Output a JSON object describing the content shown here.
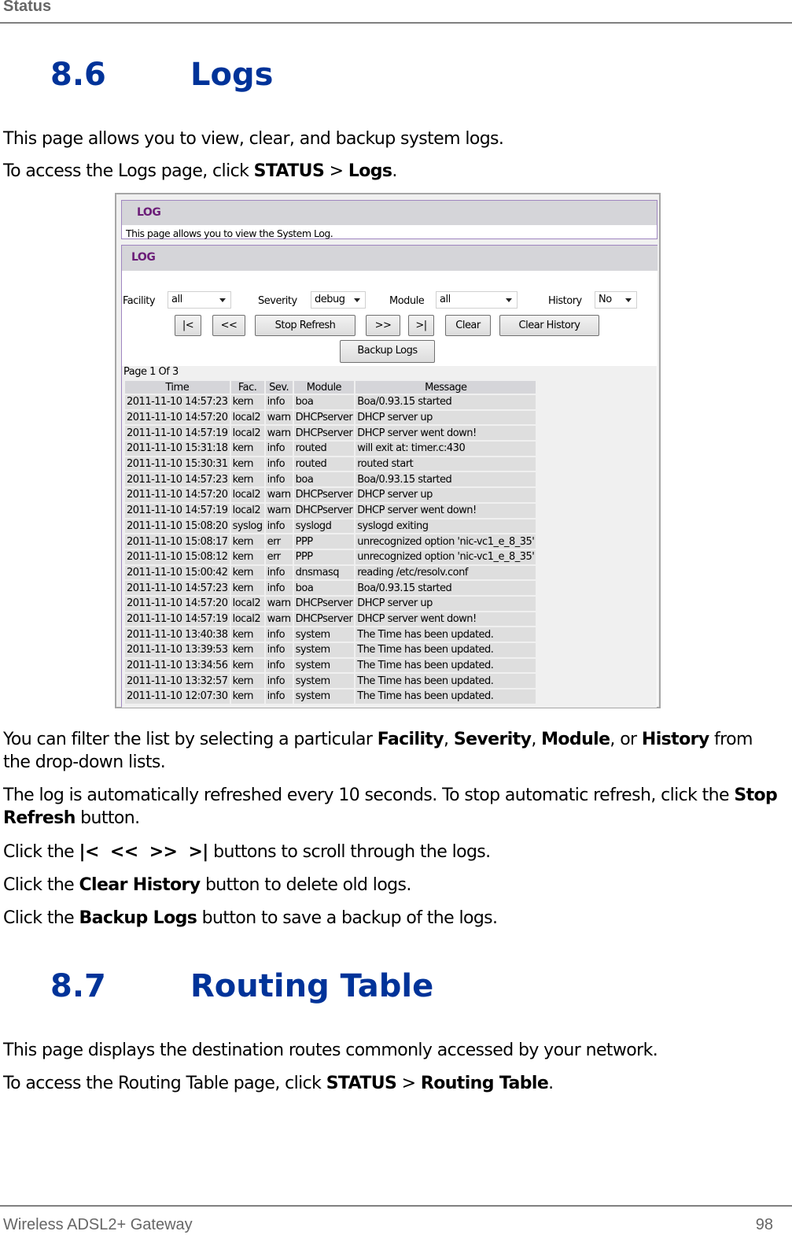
{
  "running_header": "Status",
  "section_logs": {
    "number": "8.6",
    "title": "Logs",
    "intro": "This page allows you to view, clear, and backup system logs.",
    "access_prefix": "To access the Logs page, click ",
    "access_menu": "STATUS",
    "access_sep": " > ",
    "access_page": "Logs",
    "access_suffix": "."
  },
  "screenshot": {
    "panel1_title": "LOG",
    "panel1_desc": "This page allows you to view the System Log.",
    "panel2_title": "LOG",
    "filters": {
      "facility_label": "Facility",
      "facility_value": "all",
      "severity_label": "Severity",
      "severity_value": "debug",
      "module_label": "Module",
      "module_value": "all",
      "history_label": "History",
      "history_value": "No"
    },
    "buttons": {
      "first": "|<",
      "prev": "<<",
      "stop_refresh": "Stop Refresh",
      "next": ">>",
      "last": ">|",
      "clear": "Clear",
      "clear_history": "Clear History",
      "backup_logs": "Backup Logs"
    },
    "page_info": "Page 1 Of 3",
    "columns": [
      "Time",
      "Fac.",
      "Sev.",
      "Module",
      "Message"
    ],
    "rows": [
      [
        "2011-11-10 14:57:23",
        "kern",
        "info",
        "boa",
        "Boa/0.93.15 started"
      ],
      [
        "2011-11-10 14:57:20",
        "local2",
        "warn",
        "DHCPserver",
        "DHCP server up"
      ],
      [
        "2011-11-10 14:57:19",
        "local2",
        "warn",
        "DHCPserver",
        "DHCP server went down!"
      ],
      [
        "2011-11-10 15:31:18",
        "kern",
        "info",
        "routed",
        "will exit at: timer.c:430"
      ],
      [
        "2011-11-10 15:30:31",
        "kern",
        "info",
        "routed",
        "routed start"
      ],
      [
        "2011-11-10 14:57:23",
        "kern",
        "info",
        "boa",
        "Boa/0.93.15 started"
      ],
      [
        "2011-11-10 14:57:20",
        "local2",
        "warn",
        "DHCPserver",
        "DHCP server up"
      ],
      [
        "2011-11-10 14:57:19",
        "local2",
        "warn",
        "DHCPserver",
        "DHCP server went down!"
      ],
      [
        "2011-11-10 15:08:20",
        "syslog",
        "info",
        "syslogd",
        "syslogd exiting"
      ],
      [
        "2011-11-10 15:08:17",
        "kern",
        "err",
        "PPP",
        "unrecognized option 'nic-vc1_e_8_35'"
      ],
      [
        "2011-11-10 15:08:12",
        "kern",
        "err",
        "PPP",
        "unrecognized option 'nic-vc1_e_8_35'"
      ],
      [
        "2011-11-10 15:00:42",
        "kern",
        "info",
        "dnsmasq",
        "reading /etc/resolv.conf"
      ],
      [
        "2011-11-10 14:57:23",
        "kern",
        "info",
        "boa",
        "Boa/0.93.15 started"
      ],
      [
        "2011-11-10 14:57:20",
        "local2",
        "warn",
        "DHCPserver",
        "DHCP server up"
      ],
      [
        "2011-11-10 14:57:19",
        "local2",
        "warn",
        "DHCPserver",
        "DHCP server went down!"
      ],
      [
        "2011-11-10 13:40:38",
        "kern",
        "info",
        "system",
        "The Time has been updated."
      ],
      [
        "2011-11-10 13:39:53",
        "kern",
        "info",
        "system",
        "The Time has been updated."
      ],
      [
        "2011-11-10 13:34:56",
        "kern",
        "info",
        "system",
        "The Time has been updated."
      ],
      [
        "2011-11-10 13:32:57",
        "kern",
        "info",
        "system",
        "The Time has been updated."
      ],
      [
        "2011-11-10 12:07:30",
        "kern",
        "info",
        "system",
        "The Time has been updated."
      ]
    ]
  },
  "paragraphs": {
    "filter_1": "You can filter the list by selecting a particular ",
    "filter_facility": "Facility",
    "filter_sep1": ", ",
    "filter_severity": "Severity",
    "filter_sep2": ", ",
    "filter_module": "Module",
    "filter_sep3": ", or ",
    "filter_history": "History",
    "filter_2": " from the drop-down lists.",
    "refresh_1": "The log is automatically refreshed every 10 seconds. To stop automatic refresh, click the ",
    "refresh_btn": "Stop Refresh",
    "refresh_2": " button.",
    "nav_1": "Click the ",
    "nav_btns": "|<  <<  >>  >|",
    "nav_2": " buttons to scroll through the logs.",
    "clearhist_1": "Click the ",
    "clearhist_btn": "Clear History",
    "clearhist_2": " button to delete old logs.",
    "backup_1": "Click the ",
    "backup_btn": "Backup Logs",
    "backup_2": " button to save a backup of the logs."
  },
  "section_routing": {
    "number": "8.7",
    "title": "Routing Table",
    "intro": "This page displays the destination routes commonly accessed by your network.",
    "access_prefix": "To access the Routing Table page, click ",
    "access_menu": "STATUS",
    "access_sep": " > ",
    "access_page": "Routing Table",
    "access_suffix": "."
  },
  "footer": {
    "product": "Wireless ADSL2+ Gateway",
    "page_number": "98"
  },
  "colors": {
    "heading_blue": "#003399",
    "log_title_purple": "#6b1d78",
    "panel_border": "#9f86c0"
  }
}
